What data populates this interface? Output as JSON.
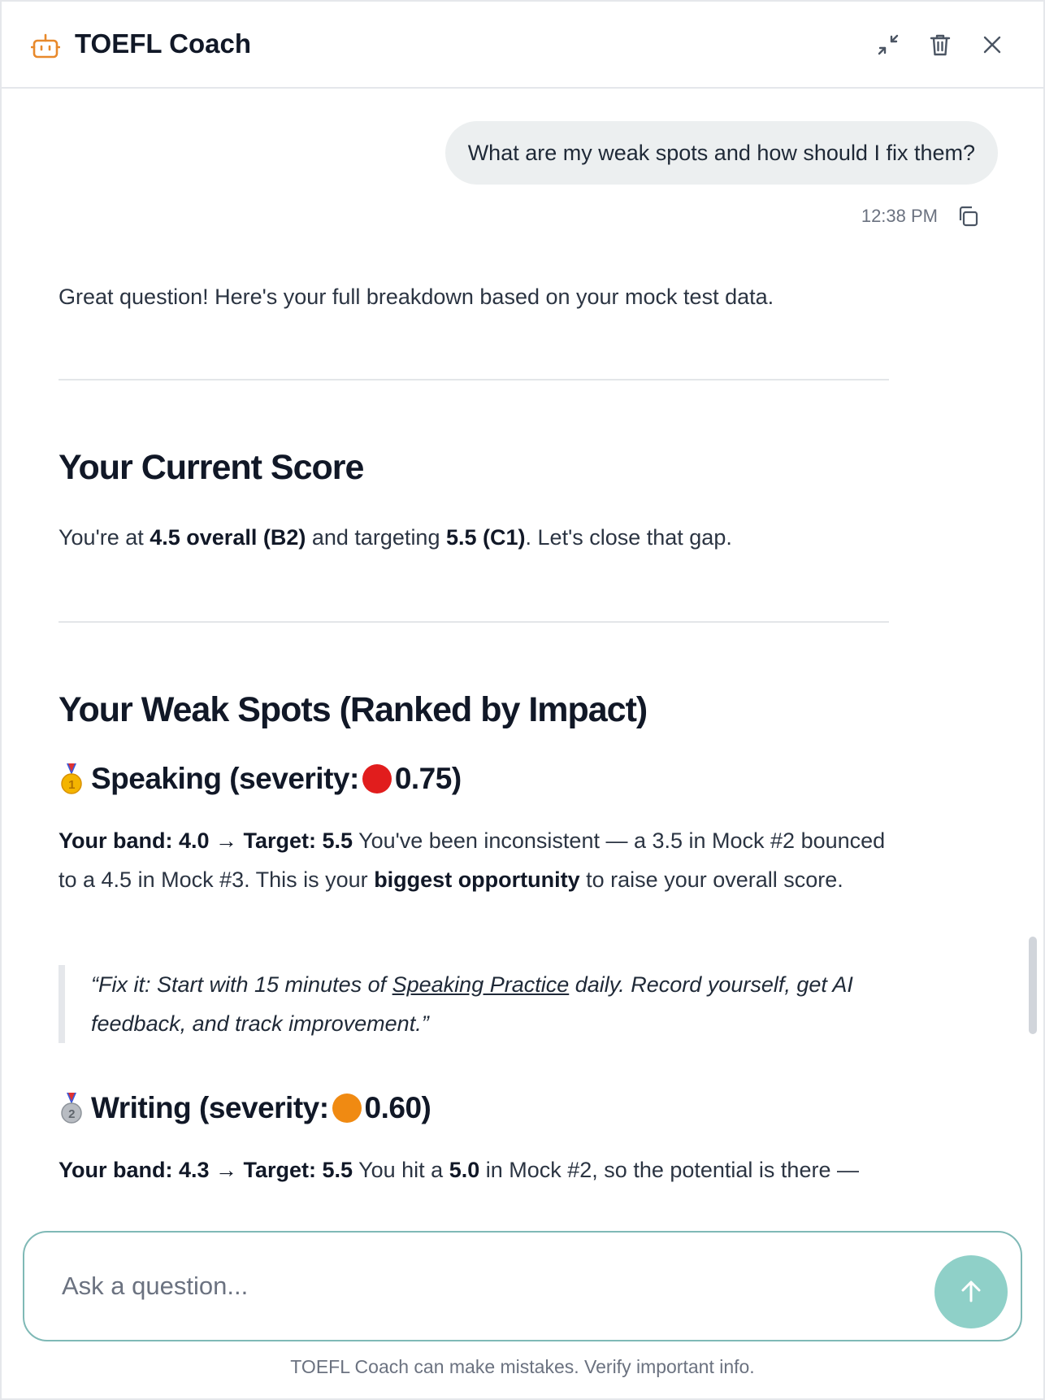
{
  "header": {
    "title": "TOEFL Coach",
    "icons": {
      "app": "robot-icon",
      "minimize": "minimize-icon",
      "delete": "trash-icon",
      "close": "close-icon"
    }
  },
  "conversation": {
    "user_message": "What are my weak spots and how should I fix them?",
    "timestamp": "12:38 PM",
    "assistant": {
      "intro": "Great question! Here's your full breakdown based on your mock test data.",
      "current_score": {
        "heading": "Your Current Score",
        "text_a": "You're at ",
        "bold_a": "4.5 overall (B2)",
        "text_b": " and targeting ",
        "bold_b": "5.5 (C1)",
        "text_c": ". Let's close that gap."
      },
      "weak_spots": {
        "heading": "Your Weak Spots (Ranked by Impact)",
        "speaking": {
          "title_prefix": "Speaking (severity:",
          "severity": "0.75)",
          "severity_color": "#e11d1d",
          "medal_number": "1",
          "band_label": "Your band: 4.0 → Target: 5.5",
          "text_a": " You've been inconsistent — a 3.5 in Mock #2 bounced to a 4.5 in Mock #3. This is your ",
          "bold": "biggest opportunity",
          "text_b": " to raise your overall score.",
          "quote_a": "“Fix it: Start with 15 minutes of ",
          "quote_link": "Speaking Practice",
          "quote_b": " daily. Record yourself, get AI feedback, and track improvement.”"
        },
        "writing": {
          "title_prefix": "Writing (severity:",
          "severity": "0.60)",
          "severity_color": "#f08a12",
          "medal_number": "2",
          "band_label": "Your band: 4.3 → Target: 5.5",
          "text_a": " You hit a ",
          "bold": "5.0",
          "text_b": " in Mock #2, so the potential is there —"
        }
      }
    }
  },
  "composer": {
    "placeholder": "Ask a question...",
    "send_icon": "arrow-up-icon"
  },
  "disclaimer": "TOEFL Coach can make mistakes. Verify important info.",
  "colors": {
    "accent": "#8fd0c8",
    "border": "#7fb9b6",
    "bot_icon": "#e8892b"
  }
}
